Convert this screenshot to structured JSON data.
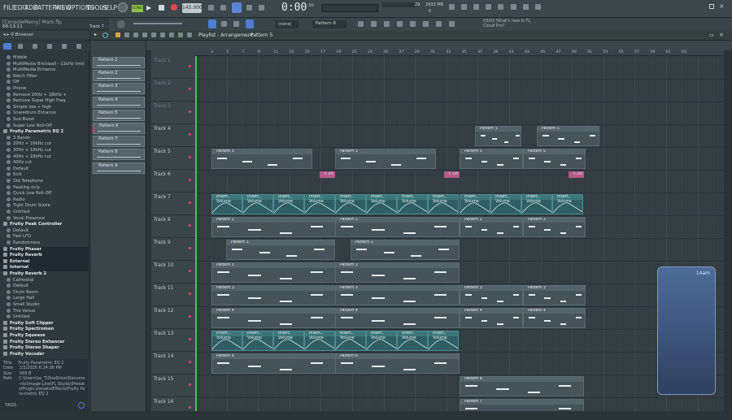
{
  "menu": [
    "FILE",
    "EDIT",
    "ADD",
    "PATTERNS",
    "VIEW",
    "OPTIONS",
    "TOOLS",
    "HELP"
  ],
  "transport": {
    "pat_song": "SONG",
    "tempo": "145.000",
    "time": "0:00",
    "time_small": ":00",
    "cpu_num": "29",
    "mem": "2933 MB",
    "mem2": "0",
    "snap": "(none)",
    "pattern": "Pattern 6",
    "news_line1": "03/03  What's new in FL",
    "news_line2": "Cloud Pro?"
  },
  "hints": {
    "project": "[ConsoleMemy]  Mam.flp",
    "position": "68:13:11",
    "track": "Track 7"
  },
  "browser": {
    "title": "Browser",
    "items": [
      {
        "t": "Middle",
        "f": false
      },
      {
        "t": "MultiMedia Brickwall - 11kHz limit",
        "f": false
      },
      {
        "t": "MultiMedia Enhance",
        "f": false
      },
      {
        "t": "Notch Filter",
        "f": false
      },
      {
        "t": "Off",
        "f": false
      },
      {
        "t": "Phone",
        "f": false
      },
      {
        "t": "Remove 20Hz + 16kHz +",
        "f": false
      },
      {
        "t": "Remove Super High Freq",
        "f": false
      },
      {
        "t": "Simple low + high",
        "f": false
      },
      {
        "t": "Snaredrum Enhance",
        "f": false
      },
      {
        "t": "Sub Boost",
        "f": false
      },
      {
        "t": "Super Low Roll-Off",
        "f": false
      },
      {
        "t": "Fruity Parametric EQ 2",
        "f": true
      },
      {
        "t": "3 Bands",
        "f": false
      },
      {
        "t": "20Hz + 16kHz cut",
        "f": false
      },
      {
        "t": "30Hz + 18kHz cut",
        "f": false
      },
      {
        "t": "40Hz + 18kHz cut",
        "f": false
      },
      {
        "t": "40Hz cut",
        "f": false
      },
      {
        "t": "Default",
        "f": false
      },
      {
        "t": "Kick",
        "f": false
      },
      {
        "t": "Old Telephone",
        "f": false
      },
      {
        "t": "Peaking only",
        "f": false
      },
      {
        "t": "Quick Low Roll-Off",
        "f": false
      },
      {
        "t": "Radio",
        "f": false
      },
      {
        "t": "Tight Drum Sizzle",
        "f": false
      },
      {
        "t": "Untitled",
        "f": false
      },
      {
        "t": "Vocal Presence",
        "f": false
      },
      {
        "t": "Fruity Peak Controller",
        "f": true
      },
      {
        "t": "Default",
        "f": false
      },
      {
        "t": "Fast LFO",
        "f": false
      },
      {
        "t": "Randomness",
        "f": false
      },
      {
        "t": "Fruity Phaser",
        "f": true
      },
      {
        "t": "Fruity Reverb",
        "f": true
      },
      {
        "t": "External",
        "f": true
      },
      {
        "t": "Internal",
        "f": true
      },
      {
        "t": "Fruity Reverb 2",
        "f": true
      },
      {
        "t": "Cathedral",
        "f": false
      },
      {
        "t": "Default",
        "f": false
      },
      {
        "t": "Drum Room",
        "f": false
      },
      {
        "t": "Large Hall",
        "f": false
      },
      {
        "t": "Small Studio",
        "f": false
      },
      {
        "t": "The Venue",
        "f": false
      },
      {
        "t": "Untitled",
        "f": false
      },
      {
        "t": "Fruity Soft Clipper",
        "f": true
      },
      {
        "t": "Fruity Spectroman",
        "f": true
      },
      {
        "t": "Fruity Squeeze",
        "f": true
      },
      {
        "t": "Fruity Stereo Enhancer",
        "f": true
      },
      {
        "t": "Fruity Stereo Shaper",
        "f": true
      },
      {
        "t": "Fruity Vocoder",
        "f": true
      }
    ]
  },
  "info": {
    "title_k": "Title",
    "title_v": "Fruity Parametric EQ 2",
    "date_k": "Date",
    "date_v": "1/2/2026 6:24:36 PM",
    "size_k": "Size",
    "size_v": "569 B",
    "path_k": "Path",
    "path_v": "C:\\Users\\ze_T\\OneDrive\\Docume-nts\\Image-Line\\FL Studio\\Presets\\Plugin presets\\Effects\\Fruity Para-metric EQ 2"
  },
  "tags_label": "TAGS",
  "playlist": {
    "title": "Playlist - Arrangement",
    "pattern": "Pattern 5"
  },
  "picker": [
    "Pattern 1",
    "Pattern 2",
    "Pattern 3",
    "Pattern 4",
    "Pattern 5",
    "Pattern 6",
    "Pattern 7",
    "Pattern 8",
    "Pattern 9"
  ],
  "ruler": [
    "3",
    "5",
    "7",
    "9",
    "11",
    "13",
    "15",
    "17",
    "19",
    "21",
    "23",
    "25",
    "27",
    "29",
    "31",
    "33",
    "35",
    "37",
    "39",
    "41",
    "43",
    "45",
    "47",
    "49",
    "51",
    "53",
    "55",
    "57",
    "59",
    "61",
    "63"
  ],
  "tracks": [
    "Track 1",
    "Track 2",
    "Track 3",
    "Track 4",
    "Track 5",
    "Track 6",
    "Track 7",
    "Track 8",
    "Track 9",
    "Track 10",
    "Track 11",
    "Track 12",
    "Track 13",
    "Track 14",
    "Track 15",
    "Track 16"
  ],
  "clips": {
    "p1": "Pattern 1",
    "p2": "Pattern 2",
    "p3": "Pattern 3",
    "p4": "Pattern 4",
    "p5": "Pattern 5",
    "p6": "Pattern 6",
    "p7": "Pattern 7",
    "p8": "Pattern 8",
    "auto": "Insert.. Volume",
    "pink": "F..ch"
  },
  "widget": {
    "label": "14am"
  }
}
